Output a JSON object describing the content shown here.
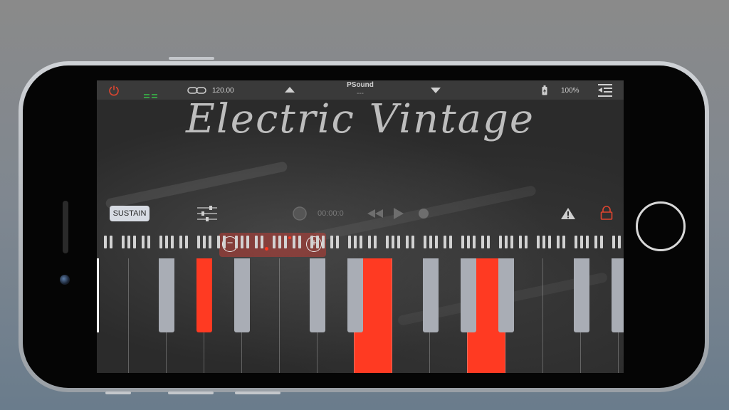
{
  "app": {
    "title": "Electric Vintage"
  },
  "topbar": {
    "tempo": "120.00",
    "preset_name": "PSound",
    "preset_sub": "---",
    "battery": "100%"
  },
  "controls": {
    "sustain_label": "SUSTAIN",
    "time": "00:00:0"
  },
  "keyboard": {
    "active_white_keys": [
      6,
      9
    ],
    "active_black_keys": [
      1
    ]
  },
  "colors": {
    "accent": "#ff3a22",
    "power": "#e0452f",
    "lock": "#e0452f",
    "midi": "#38c94a"
  },
  "icons": [
    "power-icon",
    "midi-icon",
    "link-icon",
    "arrow-up-icon",
    "arrow-down-icon",
    "battery-icon",
    "menu-icon",
    "mixer-icon",
    "record-icon",
    "rewind-icon",
    "play-icon",
    "stop-icon",
    "warning-icon",
    "lock-icon",
    "zoom-out-icon",
    "zoom-in-icon"
  ]
}
